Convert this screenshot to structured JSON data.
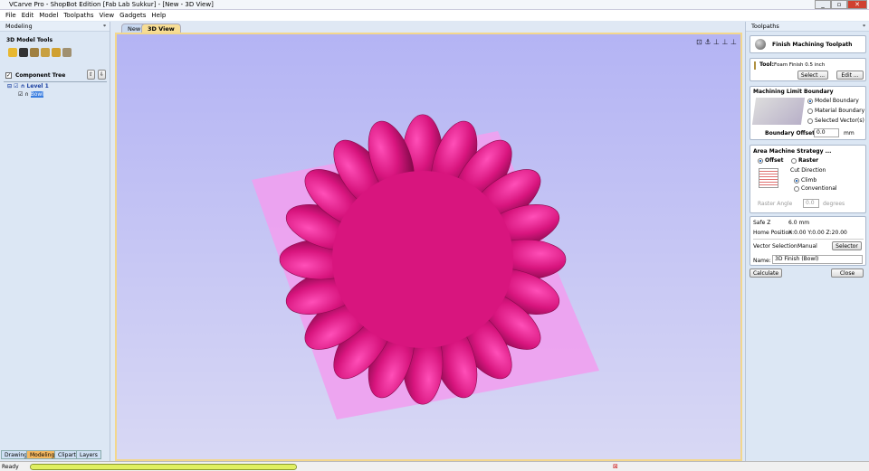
{
  "window": {
    "title": "VCarve Pro - ShopBot Edition [Fab Lab Sukkur] - [New - 3D View]",
    "min": "_",
    "max": "▫",
    "close": "✕"
  },
  "menu": [
    "File",
    "Edit",
    "Model",
    "Toolpaths",
    "View",
    "Gadgets",
    "Help"
  ],
  "left": {
    "panel_title": "Modeling",
    "pin": "ᵠ",
    "section": "3D Model Tools",
    "tools": [
      {
        "icon": "folder-icon",
        "color": "#e8b830"
      },
      {
        "icon": "wrench-icon",
        "color": "#333"
      },
      {
        "icon": "arrow-icon",
        "color": "#a08040"
      },
      {
        "icon": "texture-icon",
        "color": "#c8a040"
      },
      {
        "icon": "lock-icon",
        "color": "#d0a030"
      },
      {
        "icon": "bell-icon",
        "color": "#a09070"
      }
    ],
    "tree_title": "Component Tree",
    "tree": [
      {
        "label": "Level 1"
      },
      {
        "label": "Bowl",
        "selected": true
      }
    ]
  },
  "bottom_tabs": [
    "Drawing",
    "Modeling",
    "Clipart",
    "Layers"
  ],
  "active_bottom_tab": "Modeling",
  "doc_tabs": [
    "New",
    "3D View"
  ],
  "active_doc_tab": "3D View",
  "model": {
    "color": "#d8157e",
    "plane_color": "#f0a0f0",
    "lobes": 20
  },
  "right": {
    "panel_title": "Toolpaths",
    "heading": "Finish Machining Toolpath",
    "tool": {
      "label": "Tool:",
      "value": "Foam Finish 0.5 inch",
      "select": "Select ...",
      "edit": "Edit ..."
    },
    "boundary": {
      "title": "Machining Limit Boundary",
      "options": [
        "Model Boundary",
        "Material Boundary",
        "Selected Vector(s)"
      ],
      "selected": 0,
      "offset_label": "Boundary Offset",
      "offset": "0.0",
      "unit": "mm"
    },
    "strategy": {
      "title": "Area Machine Strategy ...",
      "offset": "Offset",
      "raster": "Raster",
      "selected": "Offset",
      "cut_direction": "Cut Direction",
      "climb": "Climb",
      "conventional": "Conventional",
      "dir_selected": "Climb",
      "raster_angle_label": "Raster Angle",
      "raster_angle": "0.0",
      "raster_unit": "degrees"
    },
    "safe_z_label": "Safe Z",
    "safe_z": "6.0 mm",
    "home_label": "Home Position",
    "home": "X:0.00 Y:0.00 Z:20.00",
    "vector_label": "Vector Selection:",
    "vector_value": "Manual",
    "selector": "Selector ...",
    "name_label": "Name:",
    "name": "3D Finish (Bowl)",
    "calculate": "Calculate",
    "close": "Close"
  },
  "status": {
    "text": "Ready",
    "progress": 1.0,
    "progress_color": "#e0ef60"
  }
}
